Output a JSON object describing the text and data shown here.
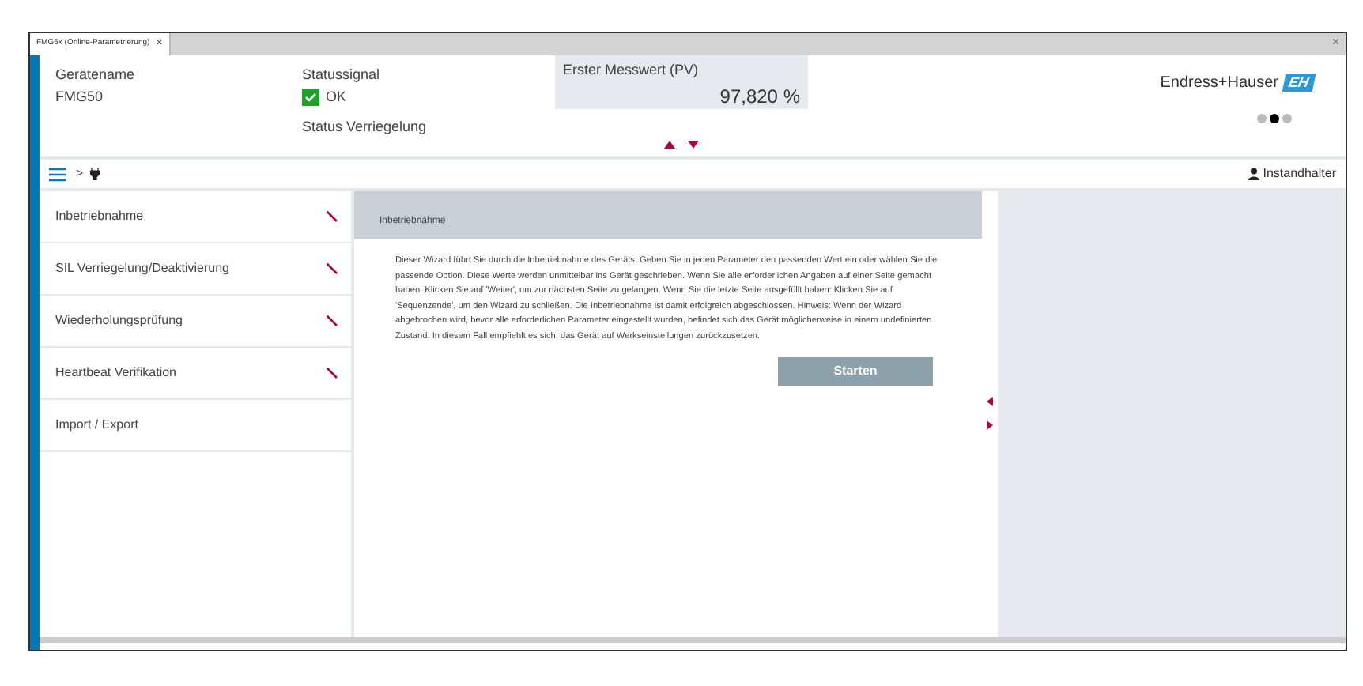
{
  "tab": {
    "label": "FMG5x (Online-Parametrierung)",
    "close": "×"
  },
  "window_close": "×",
  "header": {
    "device_label": "Gerätename",
    "device_name": "FMG50",
    "status_label": "Statussignal",
    "status_ok": true,
    "status_value": "OK",
    "lock_label": "Status Verriegelung",
    "pv_label": "Erster Messwert (PV)",
    "pv_value": "97,820 %",
    "brand": "Endress+Hauser",
    "logo": "EH",
    "pages": [
      {
        "selected": false
      },
      {
        "selected": true
      },
      {
        "selected": false
      }
    ]
  },
  "breadcrumb": {
    "separator": ">"
  },
  "user": "Instandhalter",
  "menu": [
    {
      "label": "Inbetriebnahme",
      "wizard": true
    },
    {
      "label": "SIL Verriegelung/Deaktivierung",
      "wizard": true
    },
    {
      "label": "Wiederholungsprüfung",
      "wizard": true
    },
    {
      "label": "Heartbeat Verifikation",
      "wizard": true
    },
    {
      "label": "Import / Export",
      "wizard": false
    }
  ],
  "panel": {
    "title": "Inbetriebnahme",
    "text": "Dieser Wizard führt Sie durch die Inbetriebnahme des Geräts.  Geben Sie in jeden Parameter den passenden Wert ein oder wählen Sie die passende Option. Diese Werte werden unmittelbar ins Gerät geschrieben.  Wenn Sie alle erforderlichen Angaben auf einer Seite gemacht haben: Klicken Sie auf 'Weiter', um zur nächsten Seite zu gelangen. Wenn Sie die letzte Seite ausgefüllt haben: Klicken Sie auf 'Sequenzende', um den Wizard zu schließen. Die Inbetriebnahme ist damit erfolgreich abgeschlossen.  Hinweis: Wenn der Wizard abgebrochen wird, bevor alle erforderlichen Parameter eingestellt wurden, befindet sich das Gerät möglicherweise in einem undefinierten Zustand. In diesem Fall empfiehlt es sich, das Gerät auf Werkseinstellungen zurückzusetzen.",
    "button": "Starten"
  }
}
